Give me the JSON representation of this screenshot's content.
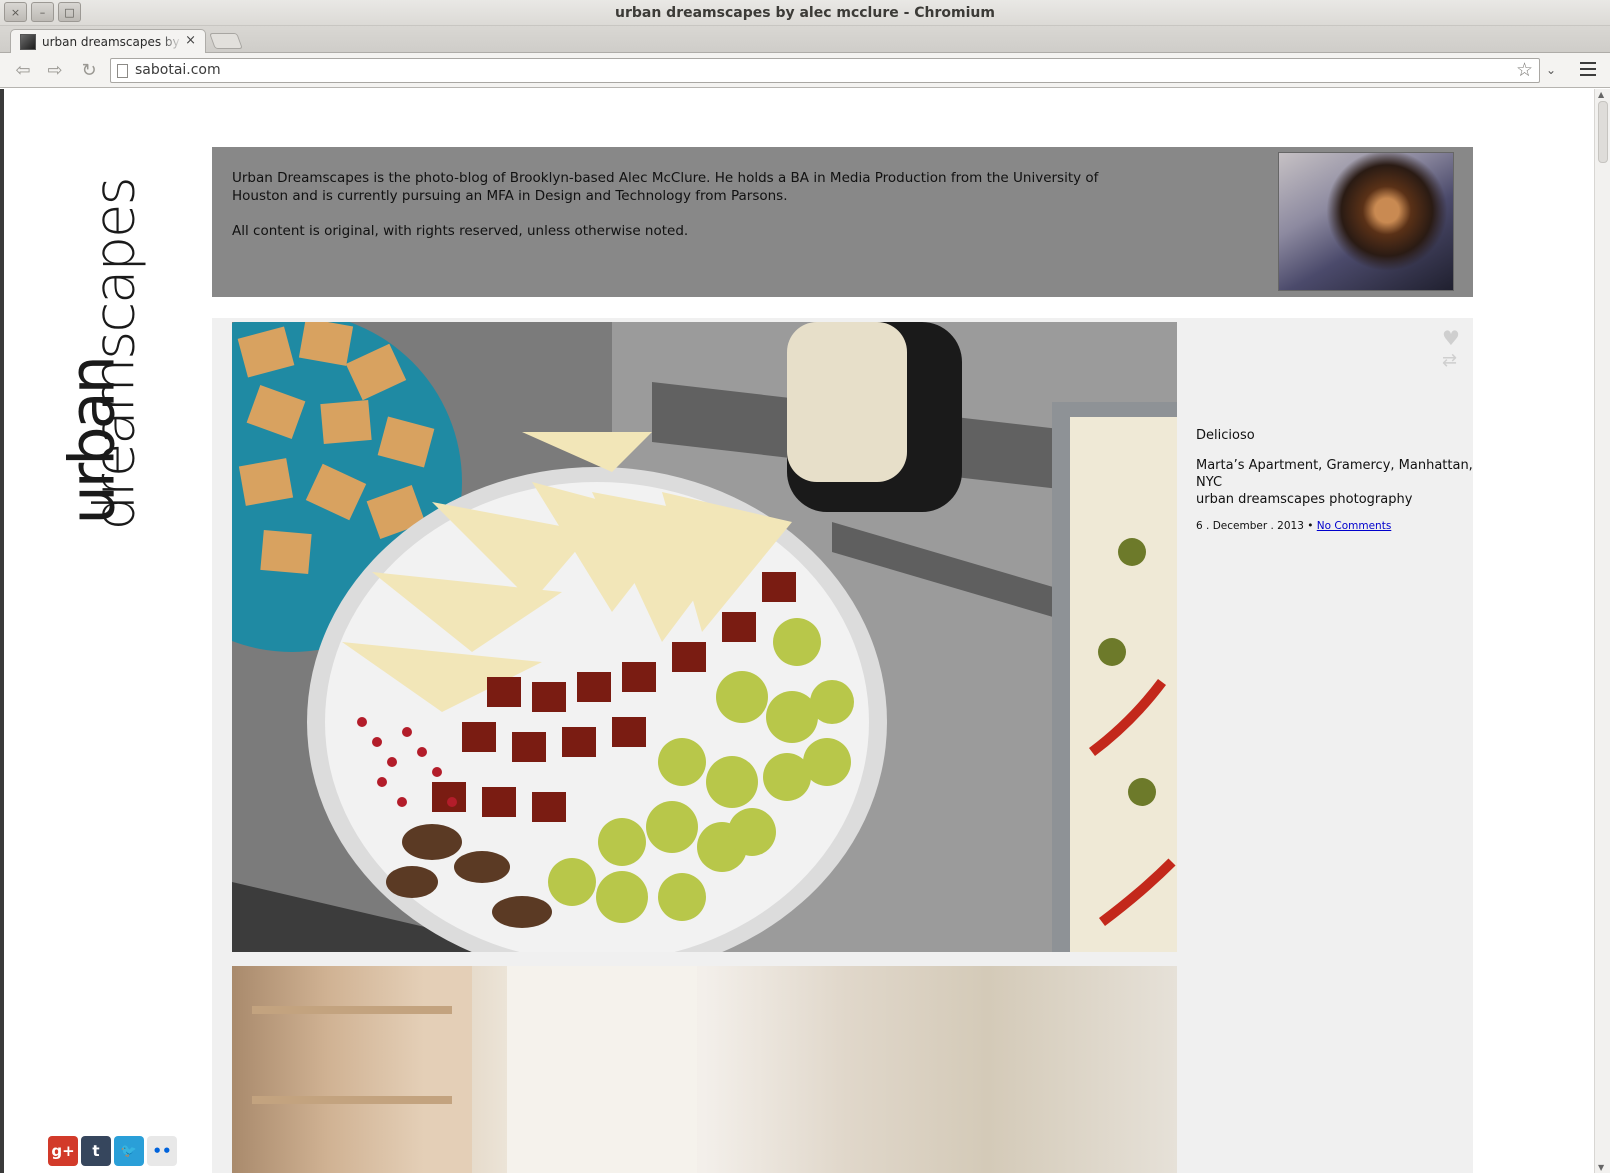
{
  "window": {
    "title": "urban dreamscapes by alec mcclure - Chromium",
    "buttons": [
      "×",
      "–",
      "□"
    ]
  },
  "tab": {
    "title": "urban dreamscapes by alec mcclure",
    "close": "×"
  },
  "toolbar": {
    "back": "⇦",
    "forward": "⇨",
    "reload": "↻",
    "url": "sabotai.com",
    "star": "☆",
    "dropdown": "⌄"
  },
  "logo": {
    "line1": "urban",
    "line2": "dreamscapes"
  },
  "bio": {
    "para1": "Urban Dreamscapes is the photo-blog of Brooklyn-based Alec McClure. He holds a BA in Media Production from the University of Houston and is currently pursuing an MFA in Design and Technology from Parsons.",
    "para2": "All content is original, with rights reserved, unless otherwise noted."
  },
  "post": {
    "title": "Delicioso",
    "location": "Marta’s Apartment, Gramercy, Manhattan, NYC",
    "credit": "urban dreamscapes photography",
    "date": "6 . December . 2013 •",
    "comments": "No Comments",
    "like_icon": "heart-icon",
    "reblog_icon": "reblog-icon"
  },
  "social": [
    {
      "label": "g+",
      "icon": "google-plus-icon",
      "color": "#d23a2a"
    },
    {
      "label": "t",
      "icon": "tumblr-icon",
      "color": "#36465d"
    },
    {
      "label": "🐦",
      "icon": "twitter-icon",
      "color": "#2a9fd8"
    },
    {
      "label": "••",
      "icon": "flickr-icon",
      "color": "#e8e8e8"
    }
  ]
}
